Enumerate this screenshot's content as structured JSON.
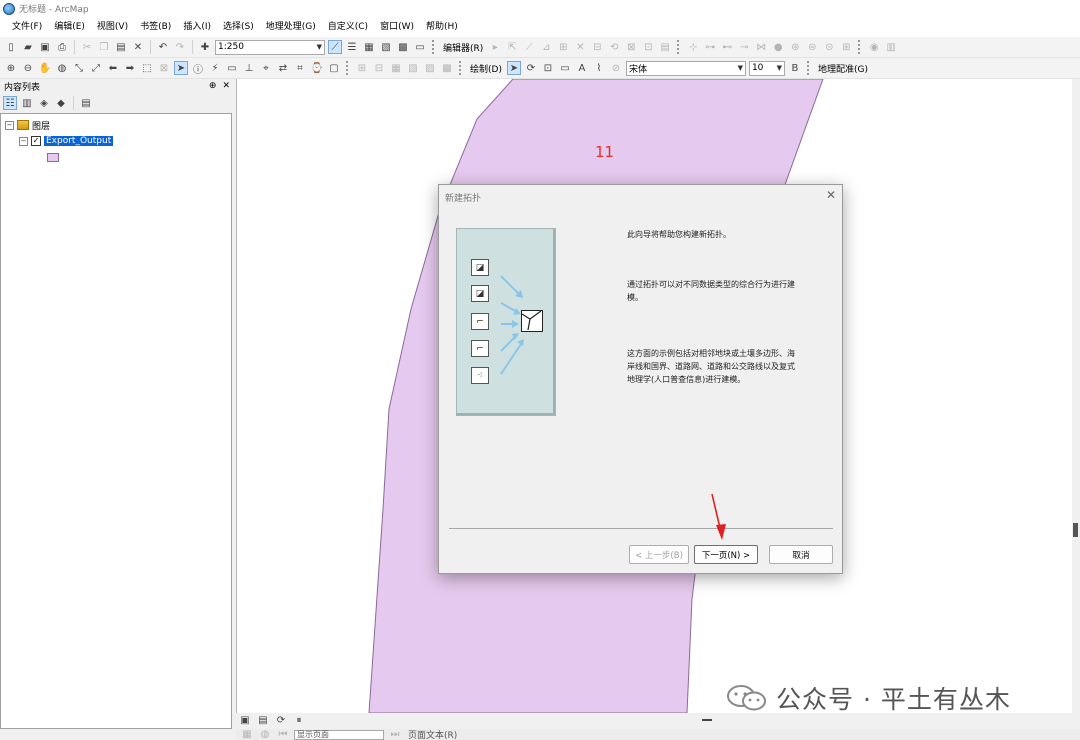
{
  "window": {
    "title": "无标题 - ArcMap"
  },
  "menu": [
    "文件(F)",
    "编辑(E)",
    "视图(V)",
    "书签(B)",
    "插入(I)",
    "选择(S)",
    "地理处理(G)",
    "自定义(C)",
    "窗口(W)",
    "帮助(H)"
  ],
  "toolbar": {
    "scale": "1:250",
    "editor_label": "编辑器(R)",
    "draw_label": "绘制(D)",
    "font_name": "宋体",
    "font_size": "10",
    "georef_label": "地理配准(G)"
  },
  "toc": {
    "title": "内容列表",
    "pin": "⊕",
    "close": "✕",
    "group_label": "图层",
    "layer_name": "Export_Output"
  },
  "map": {
    "polygon_label": "11",
    "polygon_color": "#e6c9ee"
  },
  "bottom": {
    "page_combo": "显示页面",
    "text_label": "页面文本(R)"
  },
  "dialog": {
    "title": "新建拓扑",
    "close": "✕",
    "text1": "此向导将帮助您构建新拓扑。",
    "text2": "通过拓扑可以对不同数据类型的综合行为进行建模。",
    "text3": "这方面的示例包括对相邻地块或土壤多边形、海岸线和国界、道路网、道路和公交路线以及复式地理学(人口普查信息)进行建模。",
    "back_button": "< 上一步(B)",
    "next_button": "下一页(N) >",
    "cancel_button": "取消"
  },
  "watermark": {
    "text": "公众号 · 平土有丛木"
  },
  "colors": {
    "accent": "#0a64d8",
    "annotation_arrow": "#e02020",
    "label_red": "#e03030"
  }
}
